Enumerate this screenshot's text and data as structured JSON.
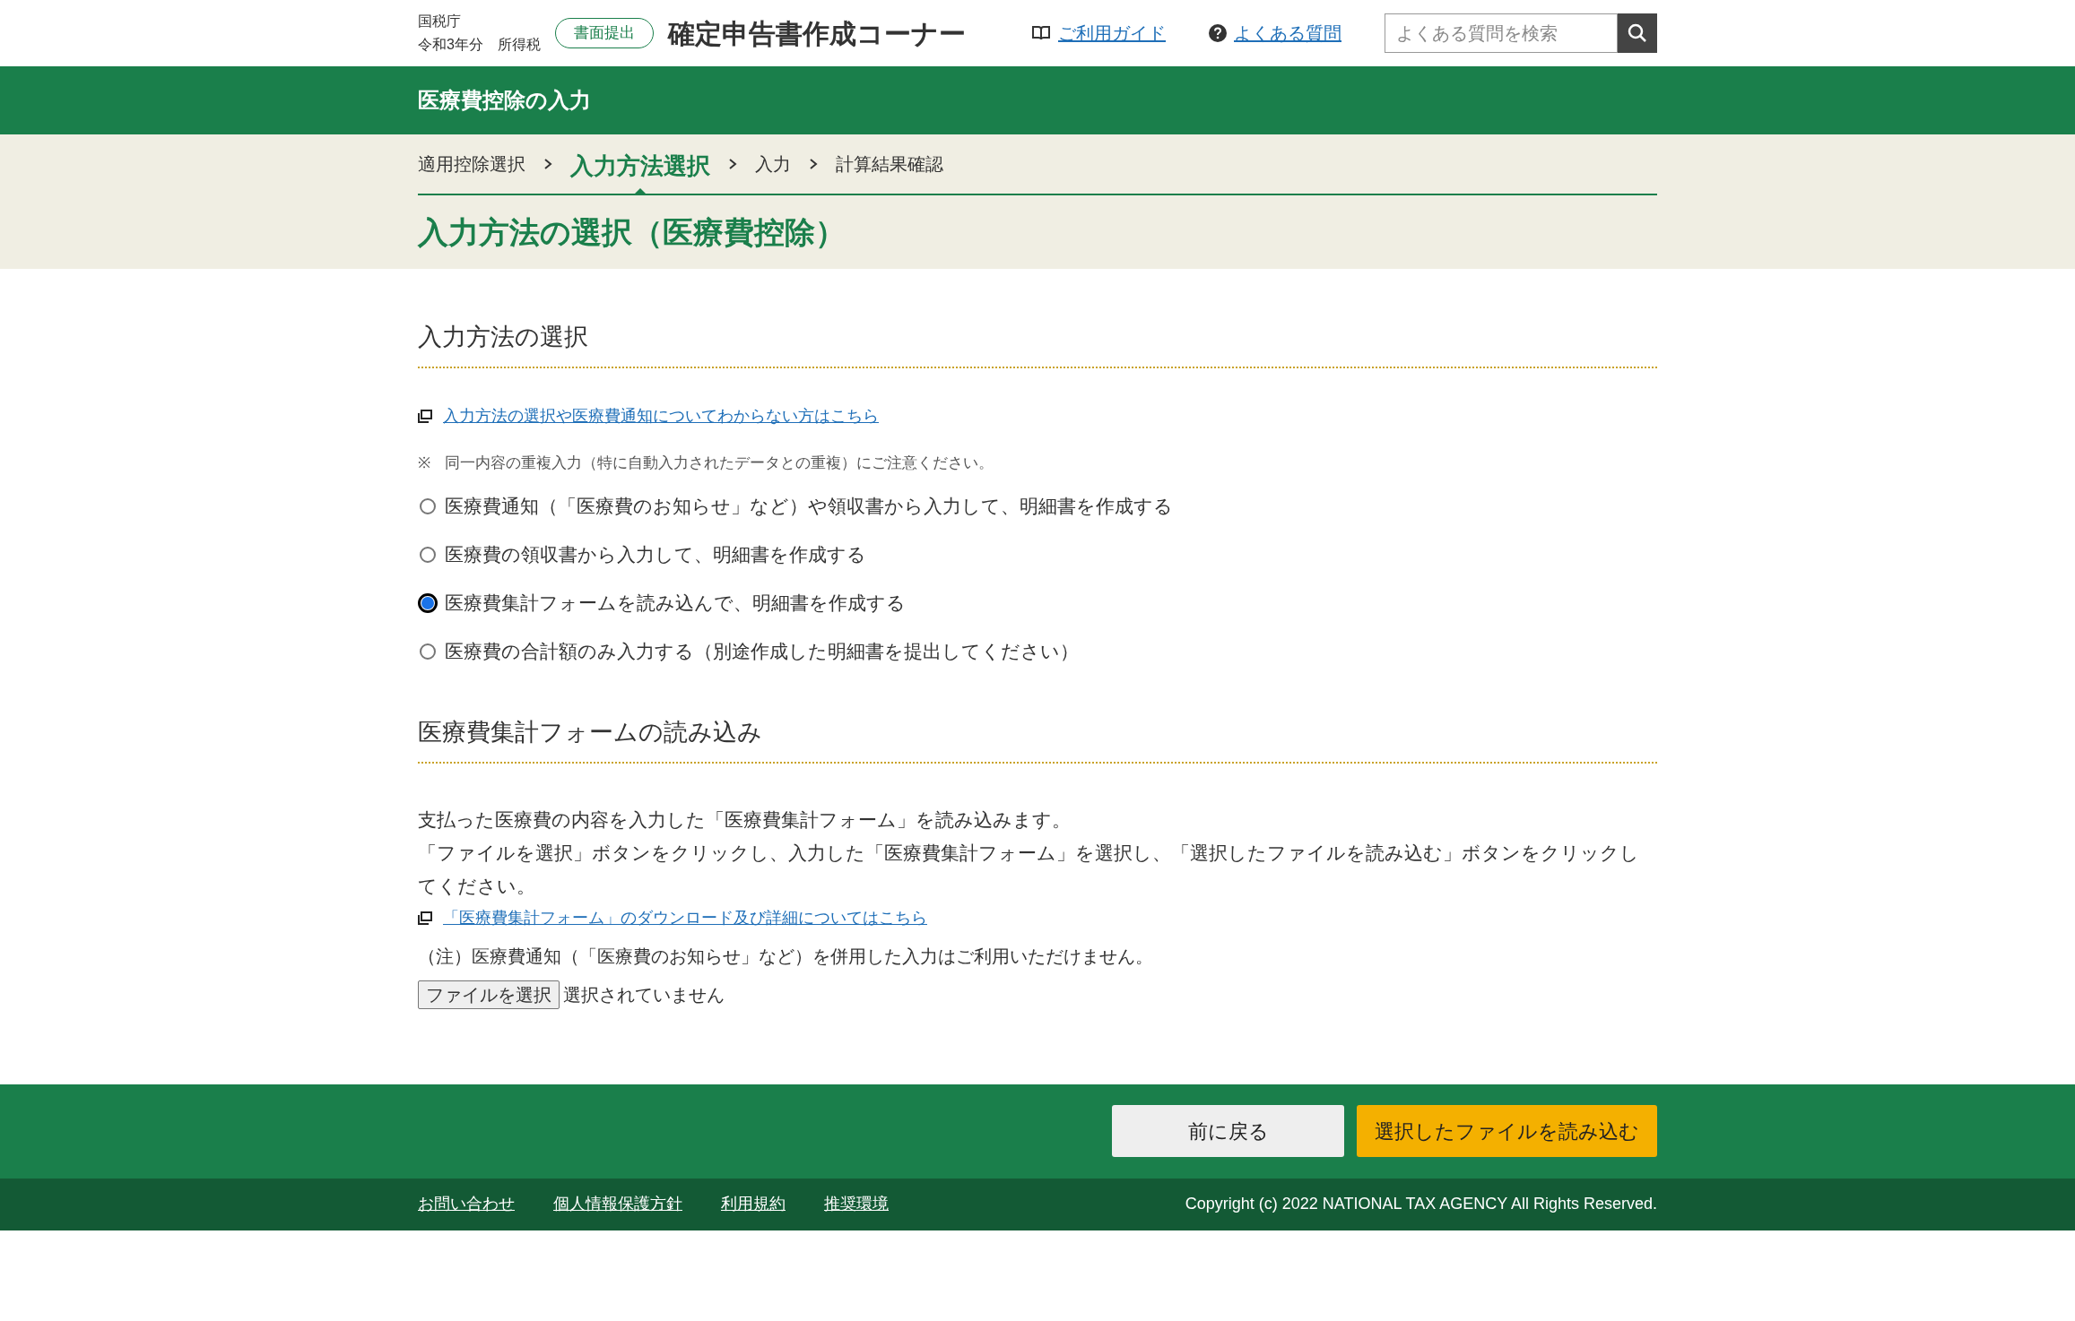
{
  "header": {
    "agency": "国税庁",
    "year": "令和3年分",
    "tax": "所得税",
    "badge": "書面提出",
    "title": "確定申告書作成コーナー",
    "links": [
      {
        "label": "ご利用ガイド",
        "kind": "guide"
      },
      {
        "label": "よくある質問",
        "kind": "faq"
      }
    ],
    "search": {
      "placeholder": "よくある質問を検索"
    }
  },
  "banner": "医療費控除の入力",
  "breadcrumb": [
    {
      "label": "適用控除選択",
      "selected": false
    },
    {
      "label": "入力方法選択",
      "selected": true
    },
    {
      "label": "入力",
      "selected": false
    },
    {
      "label": "計算結果確認",
      "selected": false
    }
  ],
  "page_title": "入力方法の選択（医療費控除）",
  "method_section": {
    "heading": "入力方法の選択",
    "help_link": "入力方法の選択や医療費通知についてわからない方はこちら",
    "note_mark": "※",
    "note": "同一内容の重複入力（特に自動入力されたデータとの重複）にご注意ください。",
    "options": [
      {
        "label": "医療費通知（「医療費のお知らせ」など）や領収書から入力して、明細書を作成する",
        "selected": false
      },
      {
        "label": "医療費の領収書から入力して、明細書を作成する",
        "selected": false
      },
      {
        "label": "医療費集計フォームを読み込んで、明細書を作成する",
        "selected": true
      },
      {
        "label": "医療費の合計額のみ入力する（別途作成した明細書を提出してください）",
        "selected": false
      }
    ]
  },
  "upload_section": {
    "heading": "医療費集計フォームの読み込み",
    "paragraphs": [
      "支払った医療費の内容を入力した「医療費集計フォーム」を読み込みます。",
      "「ファイルを選択」ボタンをクリックし、入力した「医療費集計フォーム」を選択し、「選択したファイルを読み込む」ボタンをクリックしてください。"
    ],
    "link": "「医療費集計フォーム」のダウンロード及び詳細についてはこちら",
    "note": "（注）医療費通知（「医療費のお知らせ」など）を併用した入力はご利用いただけません。",
    "file_button": "ファイルを選択",
    "file_status": "選択されていません"
  },
  "actions": [
    {
      "label": "前に戻る",
      "kind": "secondary"
    },
    {
      "label": "選択したファイルを読み込む",
      "kind": "primary"
    }
  ],
  "footer": {
    "links": [
      "お問い合わせ",
      "個人情報保護方針",
      "利用規約",
      "推奨環境"
    ],
    "copyright": "Copyright (c) 2022 NATIONAL TAX AGENCY All Rights Reserved."
  }
}
